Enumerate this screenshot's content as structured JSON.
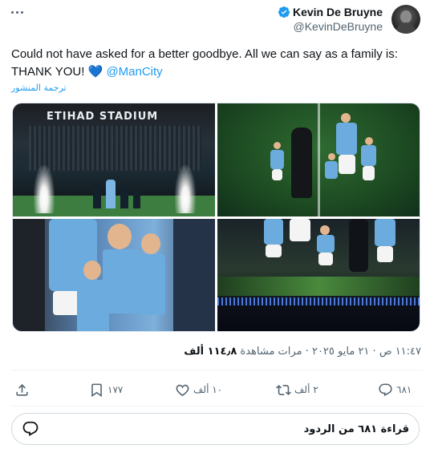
{
  "author": {
    "name": "Kevin De Bruyne",
    "handle": "@KevinDeBruyne",
    "verified_icon": "verified-badge-icon",
    "avatar_alt": "profile-photo"
  },
  "tweet": {
    "text": "Could not have asked for a better goodbye. All we can say as a family is: THANK YOU!",
    "heart": "💙",
    "mention": "@ManCity",
    "translate_label": "ترجمة المنشور"
  },
  "media": {
    "photo1_sign": "ETIHAD STADIUM"
  },
  "meta": {
    "time": "١١:٤٧ ص",
    "date": "٢١ مايو ٢٠٢٥",
    "views_value": "١١٤٫٨ ألف",
    "views_label": "مرات مشاهدة",
    "separator": "·"
  },
  "actions": {
    "reply_count": "٦٨١",
    "retweet_count": "٢ ألف",
    "like_count": "١٠ ألف",
    "bookmark_count": "١٧٧"
  },
  "reply_box": {
    "label": "قراءة ٦٨١ من الردود"
  },
  "colors": {
    "accent": "#1d9bf0",
    "muted": "#536471",
    "text": "#0f1419"
  }
}
